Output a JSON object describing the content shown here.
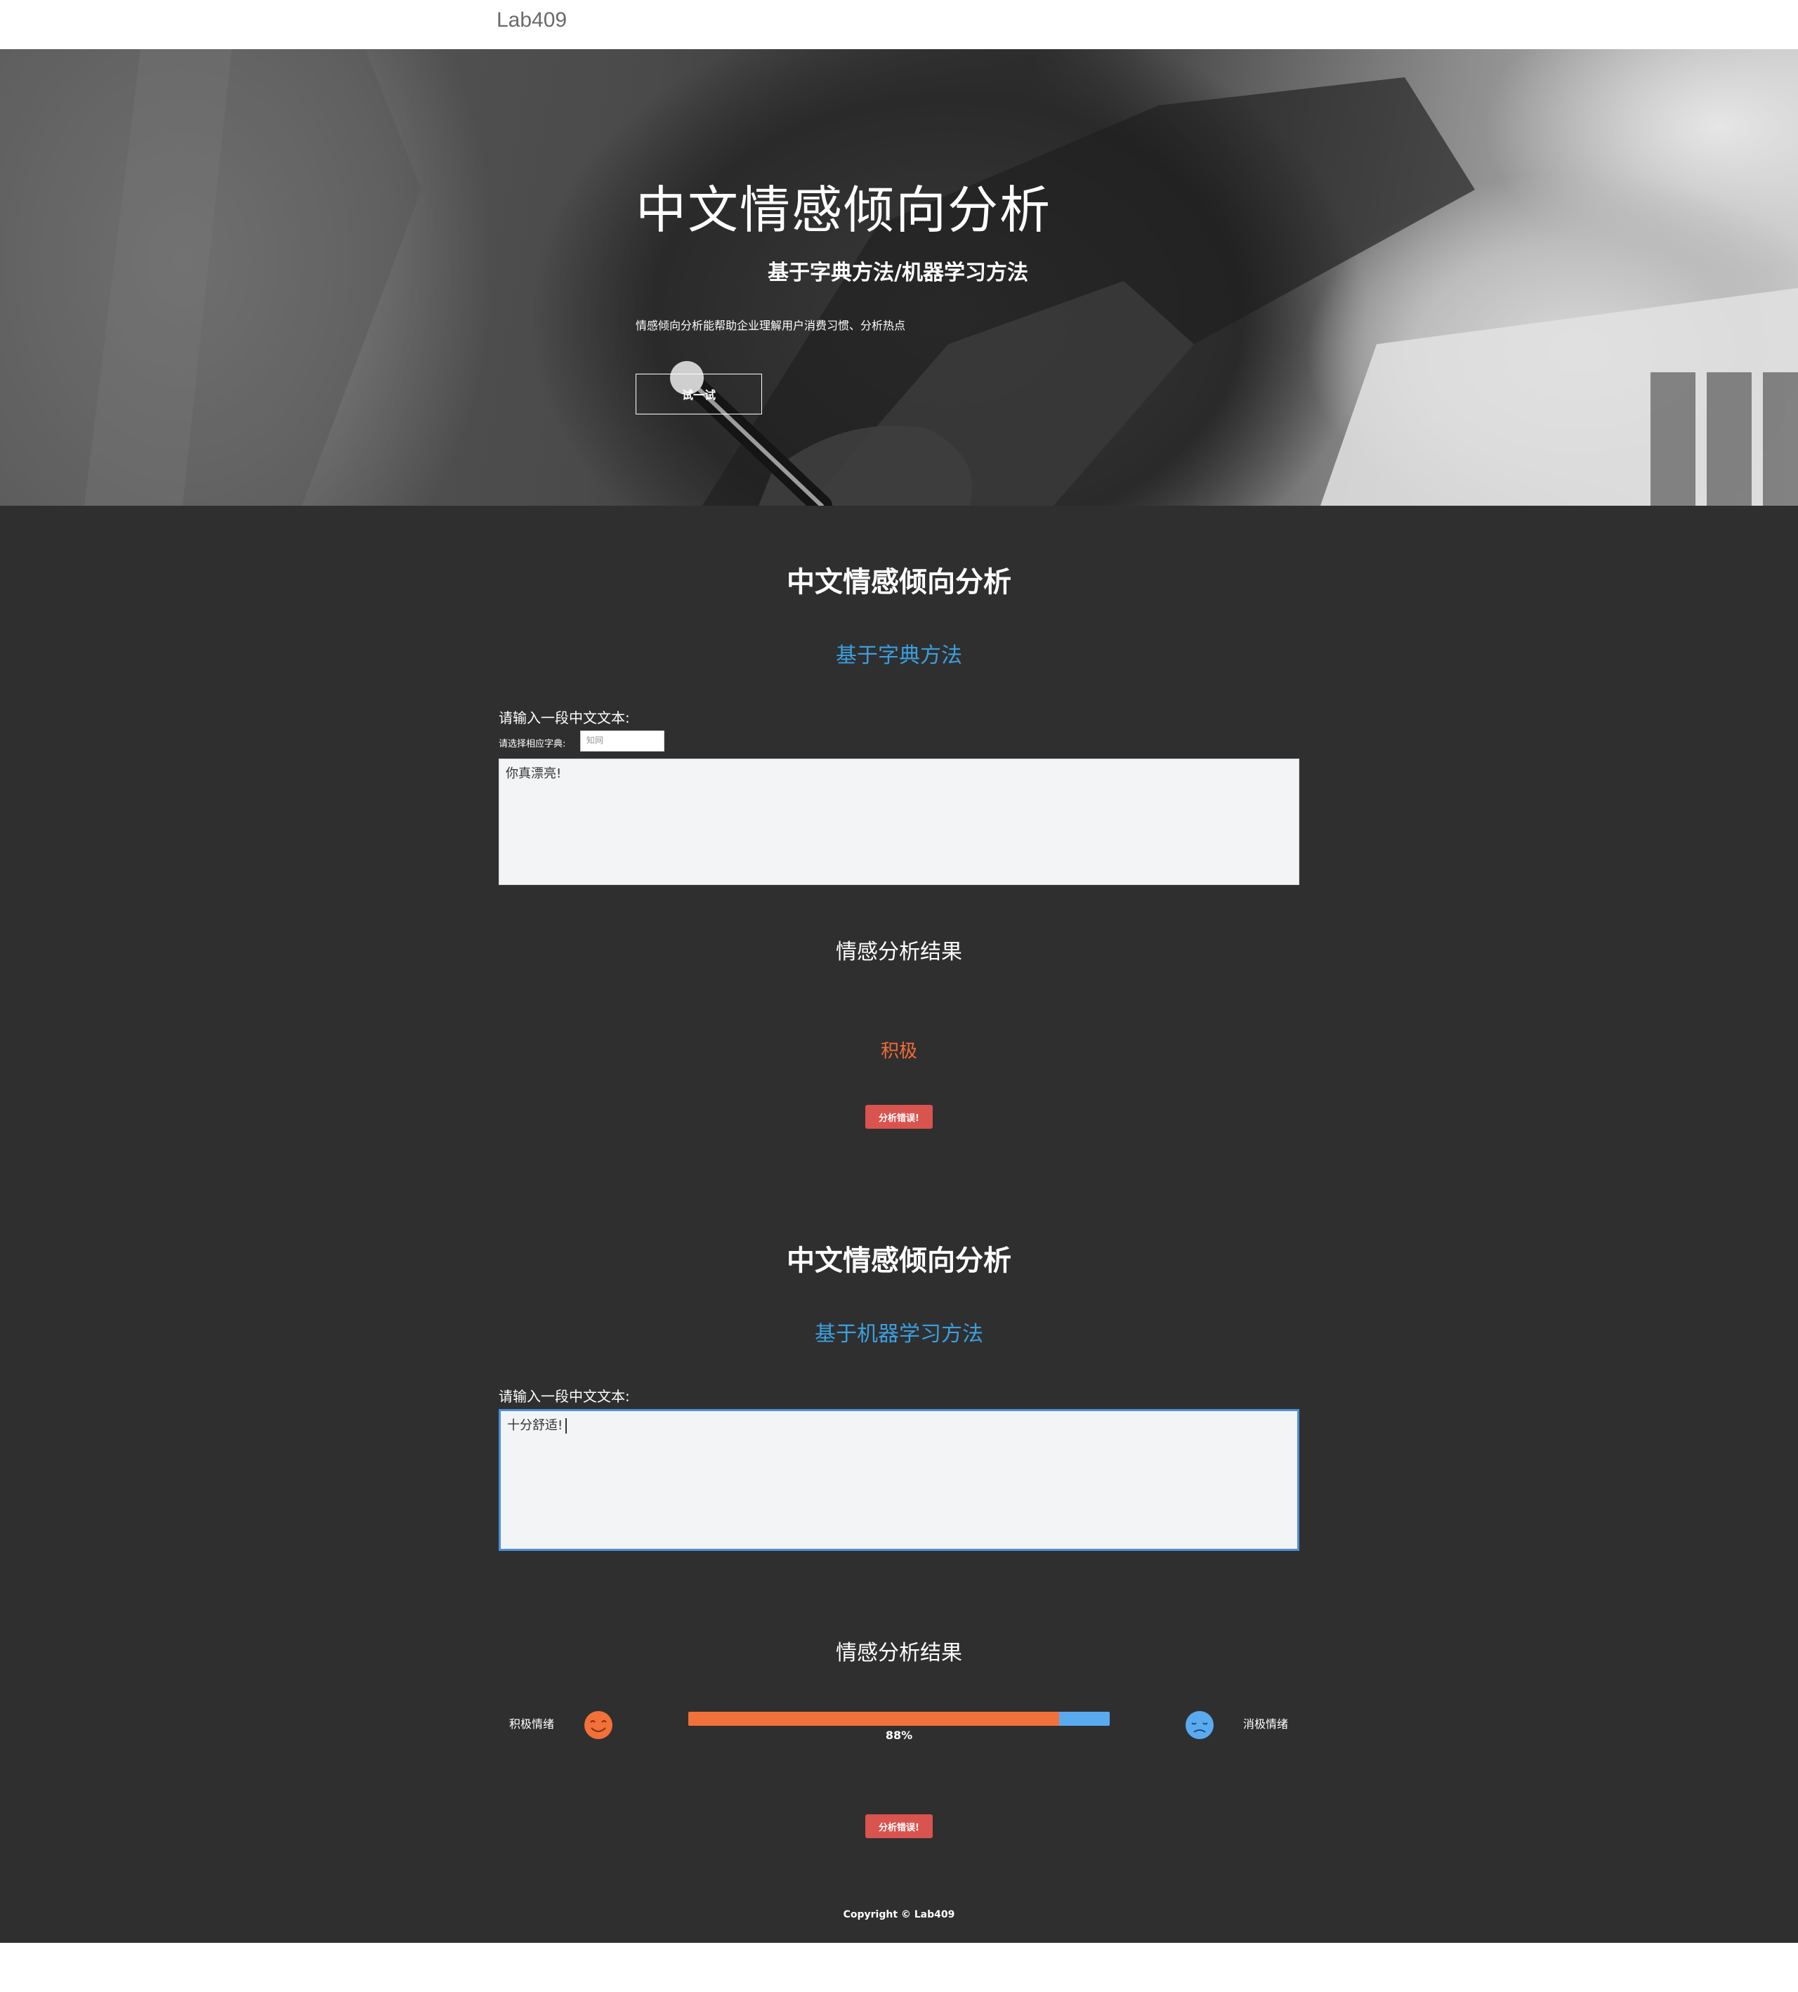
{
  "navbar": {
    "brand": "Lab409"
  },
  "hero": {
    "title": "中文情感倾向分析",
    "subtitle": "基于字典方法/机器学习方法",
    "description": "情感倾向分析能帮助企业理解用户消费习惯、分析热点",
    "button_label": "试一试"
  },
  "dictionary_section": {
    "title": "中文情感倾向分析",
    "method": "基于字典方法",
    "input_label": "请输入一段中文文本:",
    "dict_label": "请选择相应字典:",
    "dict_selected": "知网",
    "text_value": "你真漂亮!",
    "result_title": "情感分析结果",
    "result_value": "积极",
    "error_button": "分析错误!"
  },
  "ml_section": {
    "title": "中文情感倾向分析",
    "method": "基于机器学习方法",
    "input_label": "请输入一段中文文本:",
    "text_value": "十分舒适!",
    "result_title": "情感分析结果",
    "positive_label": "积极情绪",
    "negative_label": "消极情绪",
    "positive_fraction": 0.88,
    "percent_text": "88%",
    "error_button": "分析错误!"
  },
  "footer": {
    "copyright": "Copyright © Lab409"
  },
  "colors": {
    "positive": "#f2703a",
    "negative": "#5aaaf0",
    "accent": "#3b9fe0",
    "error": "#d9534f",
    "background": "#2f2f2f"
  }
}
